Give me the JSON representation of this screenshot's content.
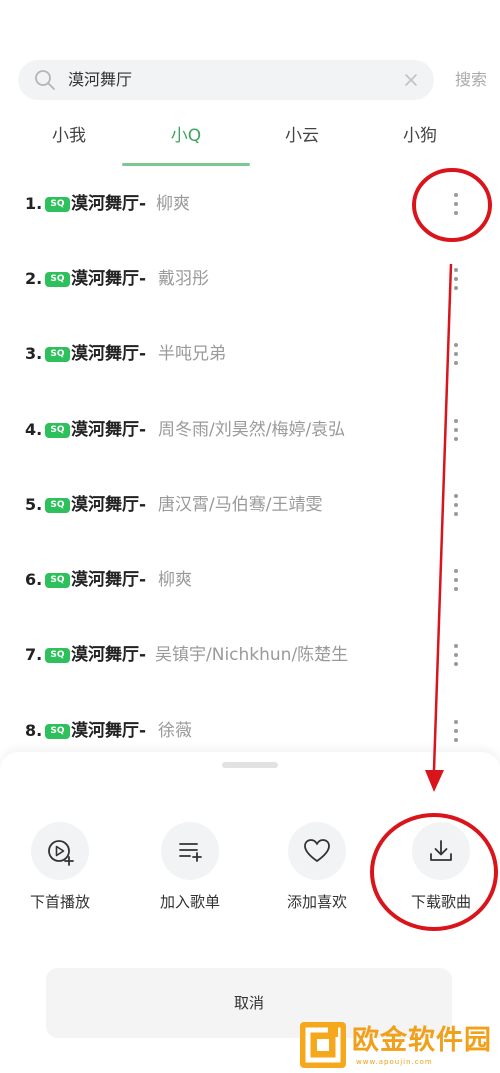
{
  "search": {
    "query": "漠河舞厅",
    "button": "搜索"
  },
  "tabs": [
    {
      "label": "小我",
      "active": false
    },
    {
      "label": "小Q",
      "active": true
    },
    {
      "label": "小云",
      "active": false
    },
    {
      "label": "小狗",
      "active": false
    }
  ],
  "songs": [
    {
      "num": "1.",
      "badge": "SQ",
      "title": "漠河舞厅",
      "sep": "-",
      "artist": "柳爽"
    },
    {
      "num": "2.",
      "badge": "SQ",
      "title": "漠河舞厅",
      "sep": "-",
      "artist": "戴羽彤"
    },
    {
      "num": "3.",
      "badge": "SQ",
      "title": "漠河舞厅",
      "sep": "-",
      "artist": "半吨兄弟"
    },
    {
      "num": "4.",
      "badge": "SQ",
      "title": "漠河舞厅",
      "sep": "-",
      "artist": "周冬雨/刘昊然/梅婷/袁弘"
    },
    {
      "num": "5.",
      "badge": "SQ",
      "title": "漠河舞厅",
      "sep": "-",
      "artist": "唐汉霄/马伯骞/王靖雯"
    },
    {
      "num": "6.",
      "badge": "SQ",
      "title": "漠河舞厅",
      "sep": "-",
      "artist": "柳爽"
    },
    {
      "num": "7.",
      "badge": "SQ",
      "title": "漠河舞厅",
      "sep": "-",
      "artist": "吴镇宇/Nichkhun/陈楚生"
    },
    {
      "num": "8.",
      "badge": "SQ",
      "title": "漠河舞厅",
      "sep": "-",
      "artist": "徐薇"
    }
  ],
  "sheet": {
    "actions": [
      {
        "label": "下首播放",
        "icon": "play-next-icon"
      },
      {
        "label": "加入歌单",
        "icon": "add-to-playlist-icon"
      },
      {
        "label": "添加喜欢",
        "icon": "heart-icon"
      },
      {
        "label": "下载歌曲",
        "icon": "download-icon"
      }
    ],
    "cancel": "取消"
  },
  "watermark": {
    "name": "欧金软件园",
    "url": "www.apoujin.com"
  },
  "colors": {
    "accent_green": "#3fa462",
    "badge_green": "#2ec05c",
    "annotation_red": "#d9141b",
    "watermark_orange": "#f5a81c"
  }
}
